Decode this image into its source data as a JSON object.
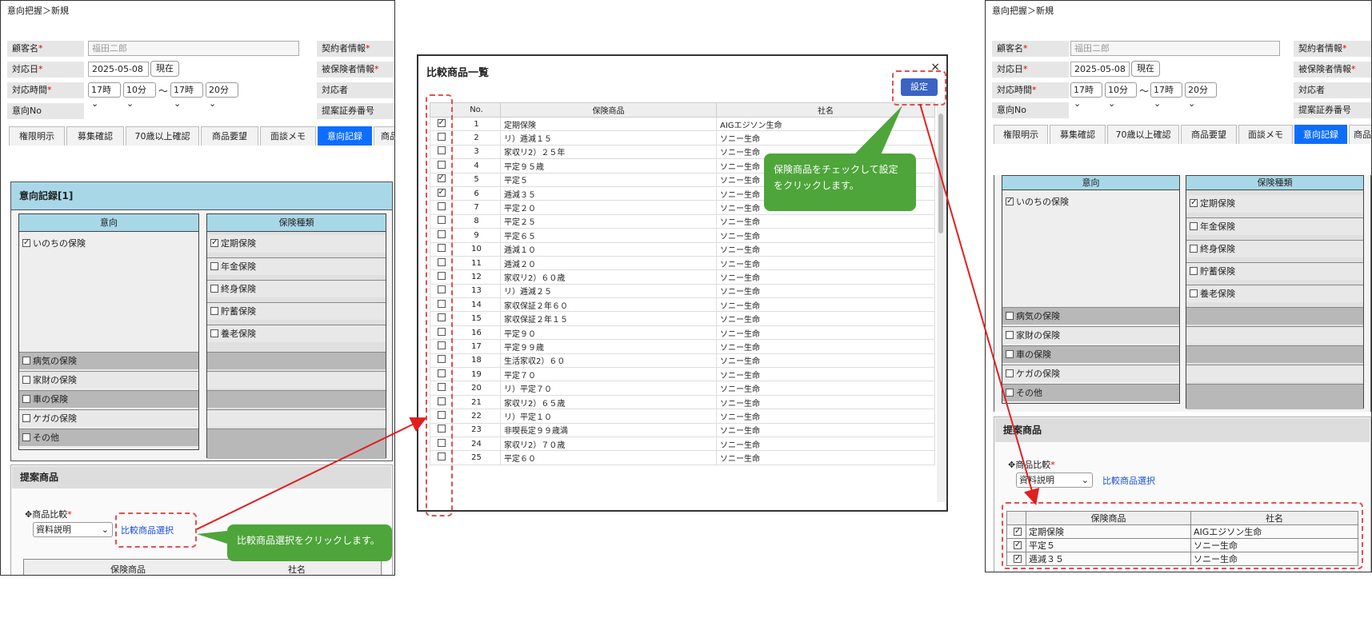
{
  "left": {
    "breadcrumb": "意向把握＞新規",
    "customer_label": "顧客名",
    "customer_value": "福田二郎",
    "contract_label": "契約者情報",
    "date_label": "対応日",
    "date_value": "2025-05-08",
    "now_button": "現在",
    "insured_label": "被保険者情報",
    "time_label": "対応時間",
    "time_h1": "17時",
    "time_m1": "10分",
    "tilde": "〜",
    "time_h2": "17時",
    "time_m2": "20分",
    "handler_label": "対応者",
    "intent_no_label": "意向No",
    "proposal_no_label": "提案証券番号",
    "tabs": [
      "権限明示",
      "募集確認",
      "70歳以上確認",
      "商品要望",
      "面談メモ",
      "意向記録",
      "商品"
    ],
    "section_title": "意向記録[1]",
    "intent_head": "意向",
    "type_head": "保険種類",
    "intent_first": "いのちの保険",
    "intent_items": [
      "病気の保険",
      "家財の保険",
      "車の保険",
      "ケガの保険",
      "その他"
    ],
    "type_items": [
      "定期保険",
      "年金保険",
      "終身保険",
      "貯蓄保険",
      "養老保険"
    ],
    "proposal_title": "提案商品",
    "compare_label": "商品比較",
    "compare_select": "資料説明",
    "compare_link": "比較商品選択",
    "table_head_product": "保険商品",
    "table_head_company": "社名",
    "check_mark": "✓"
  },
  "callout1": "比較商品選択をクリックします。",
  "callout2_line1": "保険商品をチェックして設定",
  "callout2_line2": "をクリックします。",
  "modal": {
    "title": "比較商品一覧",
    "close": "×",
    "set_button": "設定",
    "col_no": "No.",
    "col_product": "保険商品",
    "col_company": "社名",
    "rows": [
      {
        "no": "1",
        "product": "定期保険",
        "company": "AIGエジソン生命",
        "checked": true
      },
      {
        "no": "2",
        "product": "リ）逓減１５",
        "company": "ソニー生命",
        "checked": false
      },
      {
        "no": "3",
        "product": "家収リ2）２５年",
        "company": "ソニー生命",
        "checked": false
      },
      {
        "no": "4",
        "product": "平定９５歳",
        "company": "ソニー生命",
        "checked": false
      },
      {
        "no": "5",
        "product": "平定５",
        "company": "ソニー生命",
        "checked": true
      },
      {
        "no": "6",
        "product": "逓減３５",
        "company": "ソニー生命",
        "checked": true
      },
      {
        "no": "7",
        "product": "平定２０",
        "company": "ソニー生命",
        "checked": false
      },
      {
        "no": "8",
        "product": "平定２５",
        "company": "ソニー生命",
        "checked": false
      },
      {
        "no": "9",
        "product": "平定６５",
        "company": "ソニー生命",
        "checked": false
      },
      {
        "no": "10",
        "product": "逓減１０",
        "company": "ソニー生命",
        "checked": false
      },
      {
        "no": "11",
        "product": "逓減２０",
        "company": "ソニー生命",
        "checked": false
      },
      {
        "no": "12",
        "product": "家収リ2）６０歳",
        "company": "ソニー生命",
        "checked": false
      },
      {
        "no": "13",
        "product": "リ）逓減２５",
        "company": "ソニー生命",
        "checked": false
      },
      {
        "no": "14",
        "product": "家収保証２年６０",
        "company": "ソニー生命",
        "checked": false
      },
      {
        "no": "15",
        "product": "家収保証２年１５",
        "company": "ソニー生命",
        "checked": false
      },
      {
        "no": "16",
        "product": "平定９０",
        "company": "ソニー生命",
        "checked": false
      },
      {
        "no": "17",
        "product": "平定９９歳",
        "company": "ソニー生命",
        "checked": false
      },
      {
        "no": "18",
        "product": "生活家収2）６０",
        "company": "ソニー生命",
        "checked": false
      },
      {
        "no": "19",
        "product": "平定７０",
        "company": "ソニー生命",
        "checked": false
      },
      {
        "no": "20",
        "product": "リ）平定７０",
        "company": "ソニー生命",
        "checked": false
      },
      {
        "no": "21",
        "product": "家収リ2）６５歳",
        "company": "ソニー生命",
        "checked": false
      },
      {
        "no": "22",
        "product": "リ）平定１０",
        "company": "ソニー生命",
        "checked": false
      },
      {
        "no": "23",
        "product": "非喫長定９９歳満",
        "company": "ソニー生命",
        "checked": false
      },
      {
        "no": "24",
        "product": "家収リ2）７０歳",
        "company": "ソニー生命",
        "checked": false
      },
      {
        "no": "25",
        "product": "平定６０",
        "company": "ソニー生命",
        "checked": false
      }
    ]
  },
  "right": {
    "selected": [
      {
        "product": "定期保険",
        "company": "AIGエジソン生命"
      },
      {
        "product": "平定５",
        "company": "ソニー生命"
      },
      {
        "product": "逓減３５",
        "company": "ソニー生命"
      }
    ]
  }
}
